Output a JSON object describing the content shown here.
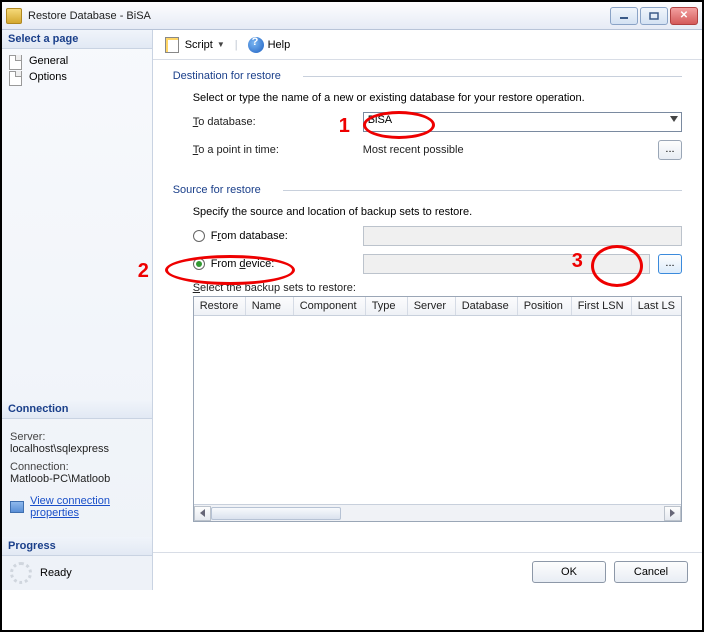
{
  "window": {
    "title": "Restore Database - BiSA"
  },
  "left": {
    "select_page_hdr": "Select a page",
    "pages": [
      "General",
      "Options"
    ],
    "connection_hdr": "Connection",
    "server_label": "Server:",
    "server_value": "localhost\\sqlexpress",
    "conn_label": "Connection:",
    "conn_value": "Matloob-PC\\Matloob",
    "view_conn_link": "View connection properties",
    "progress_hdr": "Progress",
    "progress_state": "Ready"
  },
  "toolbar": {
    "script": "Script",
    "help": "Help"
  },
  "dest": {
    "group": "Destination for restore",
    "desc": "Select or type the name of a new or existing database for your restore operation.",
    "to_db_label": "To database:",
    "to_db_value": "BiSA",
    "to_time_label": "To a point in time:",
    "to_time_value": "Most recent possible"
  },
  "source": {
    "group": "Source for restore",
    "desc": "Specify the source and location of backup sets to restore.",
    "from_db_label": "From database:",
    "from_device_label": "From device:",
    "selected_radio": "device",
    "ellipsis": "...",
    "select_sets_label": "Select the backup sets to restore:",
    "grid_cols": [
      "Restore",
      "Name",
      "Component",
      "Type",
      "Server",
      "Database",
      "Position",
      "First LSN",
      "Last LS"
    ]
  },
  "footer": {
    "ok": "OK",
    "cancel": "Cancel"
  },
  "annotations": {
    "n1": "1",
    "n2": "2",
    "n3": "3"
  }
}
